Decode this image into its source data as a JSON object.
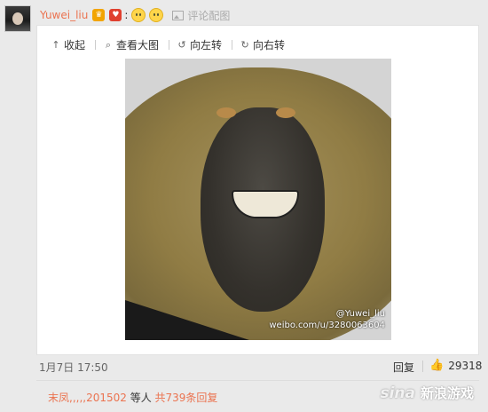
{
  "post": {
    "username": "Yuwei_liu",
    "colon": ":",
    "comment_with_image": "评论配图"
  },
  "toolbar": {
    "collapse": "收起",
    "view_large": "查看大图",
    "rotate_left": "向左转",
    "rotate_right": "向右转"
  },
  "image": {
    "watermark_line1": "@Yuwei_liu",
    "watermark_line2": "weibo.com/u/3280063604"
  },
  "meta": {
    "date": "1月7日 17:50",
    "reply_label": "回复",
    "like_count": "29318"
  },
  "footer": {
    "names": "末凤,,,,,201502",
    "mid": " 等人 ",
    "total": "共739条回复"
  },
  "brand": {
    "sina": "sina",
    "name": "新浪游戏"
  },
  "colors": {
    "accent": "#eb7350",
    "background": "#eaeaea",
    "panel": "#ffffff"
  }
}
